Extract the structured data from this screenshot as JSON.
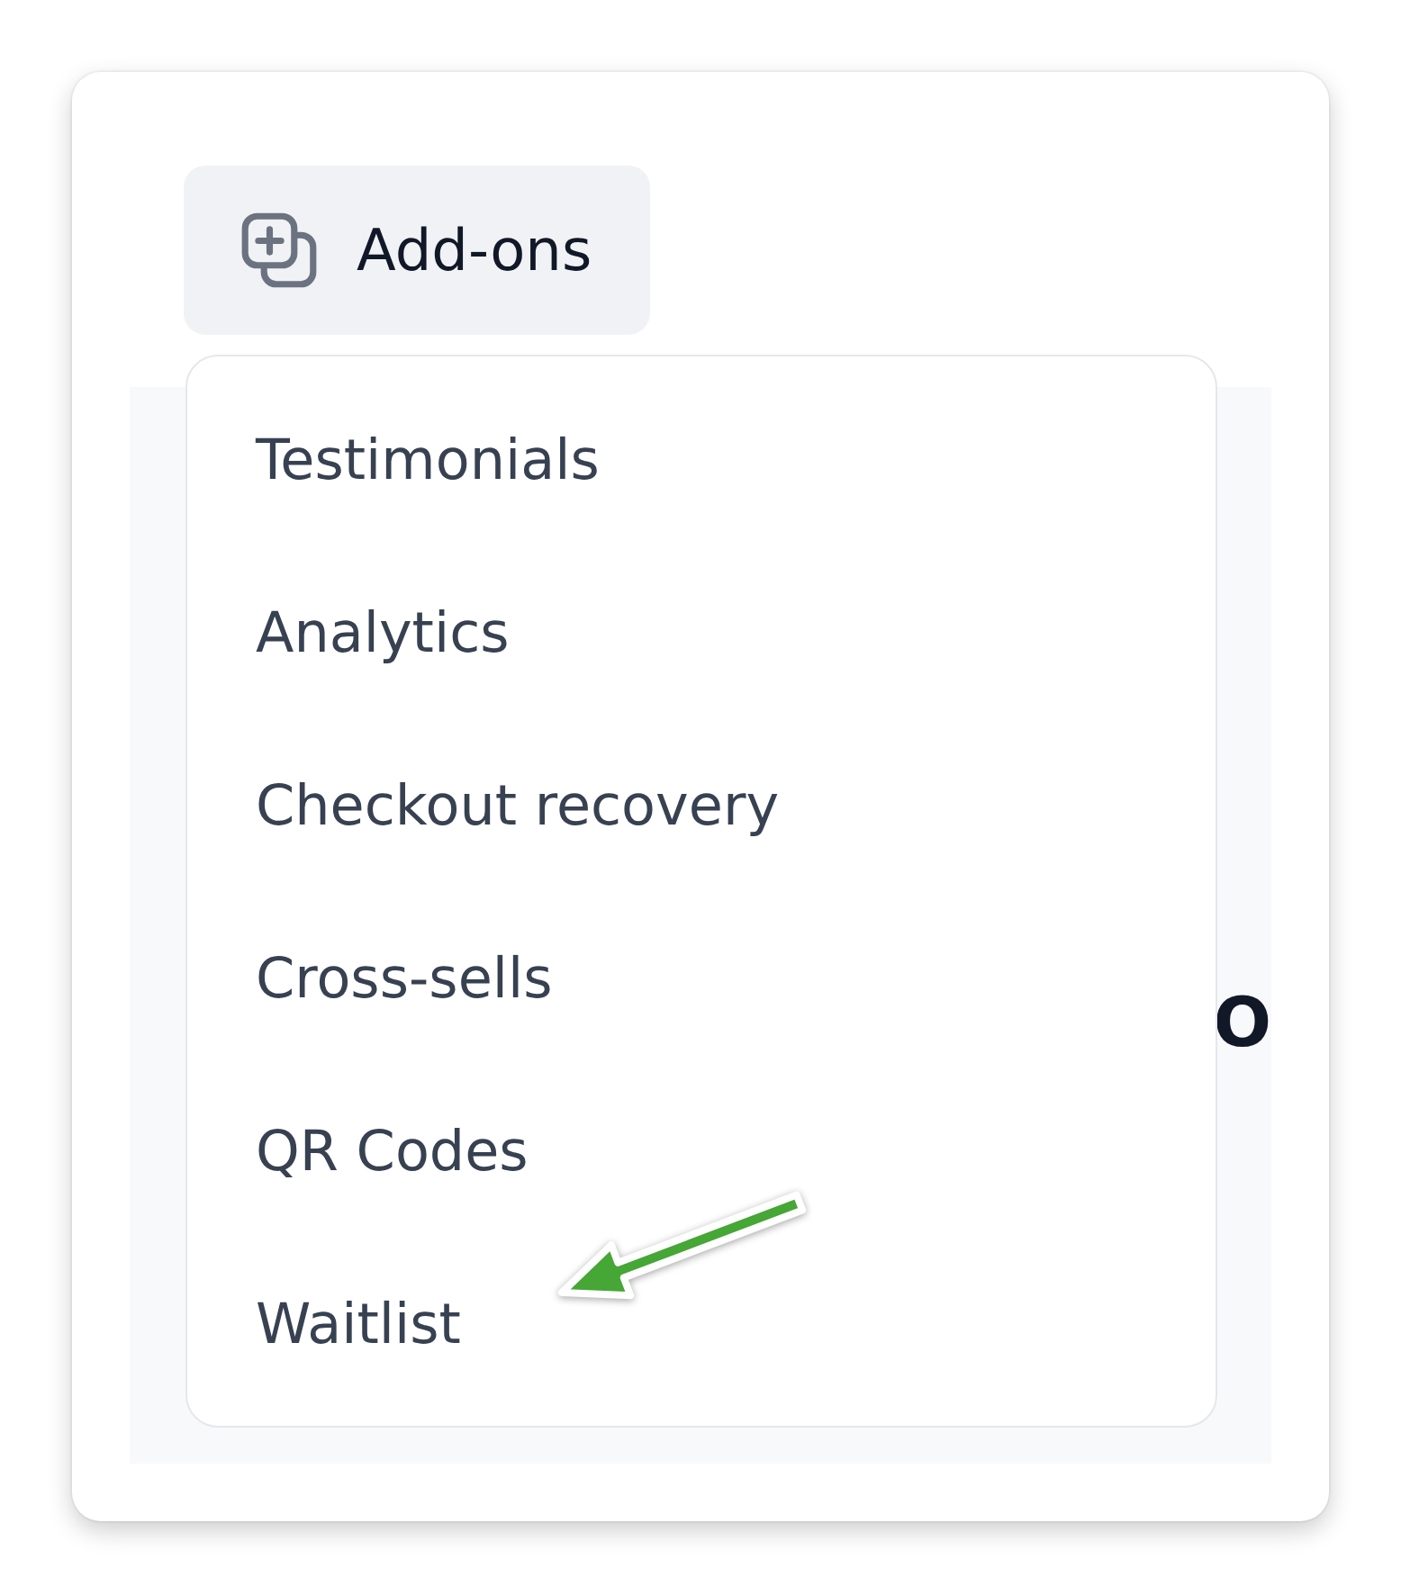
{
  "addons_button": {
    "label": "Add-ons"
  },
  "background_panel": {
    "heading": "O"
  },
  "dropdown": {
    "items": [
      {
        "label": "Testimonials",
        "marked": false
      },
      {
        "label": "Analytics",
        "marked": false
      },
      {
        "label": "Checkout recovery",
        "marked": false
      },
      {
        "label": "Cross-sells",
        "marked": false
      },
      {
        "label": "QR Codes",
        "marked": false
      },
      {
        "label": "Waitlist",
        "marked": true
      }
    ]
  }
}
